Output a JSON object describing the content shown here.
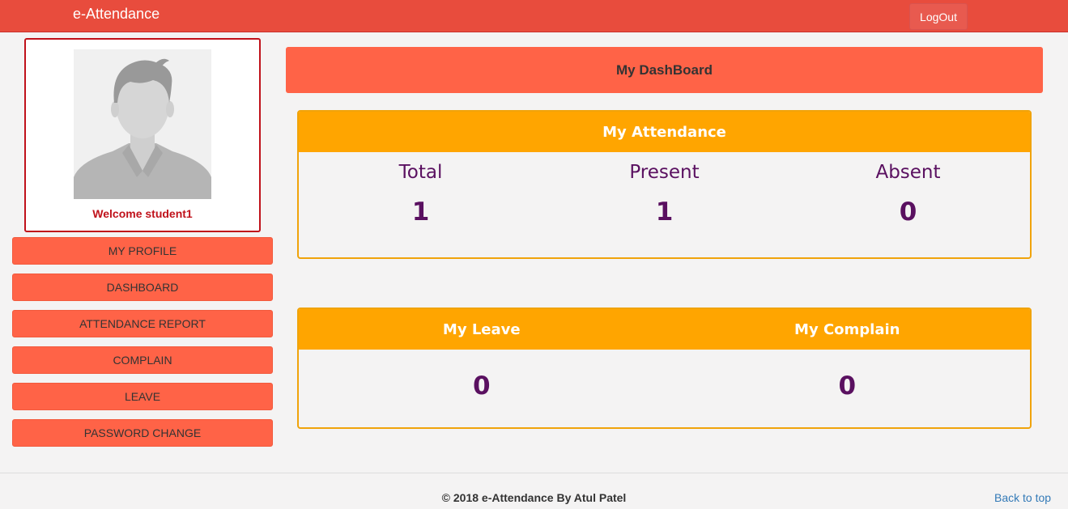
{
  "navbar": {
    "brand": "e-Attendance",
    "logout_label": "LogOut"
  },
  "profile": {
    "welcome": "Welcome student1",
    "avatar_icon": "user-silhouette-icon"
  },
  "menu": [
    {
      "label": "MY PROFILE"
    },
    {
      "label": "DASHBOARD"
    },
    {
      "label": "ATTENDANCE REPORT"
    },
    {
      "label": "COMPLAIN"
    },
    {
      "label": "LEAVE"
    },
    {
      "label": "PASSWORD CHANGE"
    }
  ],
  "dashboard": {
    "title": "My DashBoard"
  },
  "attendance": {
    "title": "My Attendance",
    "total_label": "Total",
    "total_value": "1",
    "present_label": "Present",
    "present_value": "1",
    "absent_label": "Absent",
    "absent_value": "0"
  },
  "leave_complain": {
    "leave_title": "My Leave",
    "leave_value": "0",
    "complain_title": "My Complain",
    "complain_value": "0"
  },
  "footer": {
    "copyright": "© 2018 e-Attendance By Atul Patel",
    "back_to_top": "Back to top"
  },
  "colors": {
    "nav": "#e84c3d",
    "button": "#ff6347",
    "panel_header": "#ffa500",
    "stat_text": "#5a1060",
    "welcome_text": "#c0121b"
  }
}
